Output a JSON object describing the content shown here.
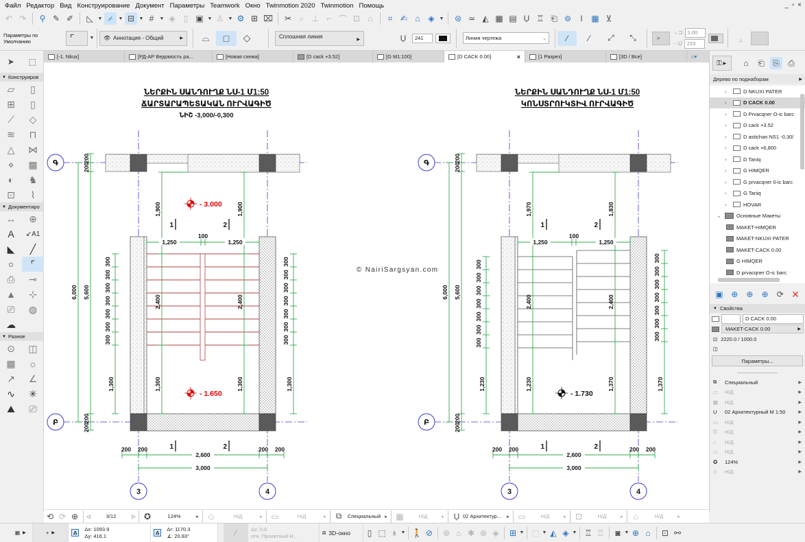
{
  "menu": [
    "Файл",
    "Редактор",
    "Вид",
    "Конструирование",
    "Документ",
    "Параметры",
    "Teamwork",
    "Окно",
    "Twinmotion 2020",
    "Twinmotion",
    "Помощь"
  ],
  "window_controls": "_ ▫ ×",
  "infobox": {
    "favorites_label": "Параметры по Умолчанию",
    "layer": "Аннотация - Общий",
    "line_type": "Сплошная линия",
    "pen_number": "241",
    "line_category": "Линия чертежа",
    "scale_value": "1.00",
    "pen_value_2": "223"
  },
  "tabs": [
    {
      "label": "[-1. Nkux]",
      "active": false
    },
    {
      "label": "[РД-АР Ведомость ра...",
      "active": false
    },
    {
      "label": "[Новая схема]",
      "active": false
    },
    {
      "label": "[D cack +3.52]",
      "active": false
    },
    {
      "label": "[G M1:100]",
      "active": false
    },
    {
      "label": "[D CACK 0.00]",
      "active": true
    },
    {
      "label": "[1 Разрез]",
      "active": false
    },
    {
      "label": "[3D / Все]",
      "active": false
    }
  ],
  "toolbox": {
    "sections": [
      "Конструиров",
      "Документиро",
      "Разное"
    ]
  },
  "navigator": {
    "mode": "Дерево по поднаборам",
    "items": [
      {
        "label": "D NKUXI PATER",
        "type": "view",
        "selected": false
      },
      {
        "label": "D CACK 0.00",
        "type": "view",
        "selected": true
      },
      {
        "label": "D Prvacqner O-ic barc",
        "type": "view",
        "selected": false
      },
      {
        "label": "D cack +3.52",
        "type": "view",
        "selected": false
      },
      {
        "label": "D astichan NS1 -0,30/",
        "type": "view",
        "selected": false
      },
      {
        "label": "D cack +6,800",
        "type": "view",
        "selected": false
      },
      {
        "label": "D Taniq",
        "type": "view",
        "selected": false
      },
      {
        "label": "G HIMQER",
        "type": "view",
        "selected": false
      },
      {
        "label": "G prvacqner 0-ic barc",
        "type": "view",
        "selected": false
      },
      {
        "label": "G Taniq",
        "type": "view",
        "selected": false
      },
      {
        "label": "HOVAR",
        "type": "view",
        "selected": false
      },
      {
        "label": "Основные Макеты",
        "type": "folder",
        "selected": false
      },
      {
        "label": "MAKET-HIMQER",
        "type": "layout",
        "selected": false
      },
      {
        "label": "MAKET-NKUXI PATER",
        "type": "layout",
        "selected": false
      },
      {
        "label": "MAKET-CACK 0.00",
        "type": "layout",
        "selected": false
      },
      {
        "label": "G HIMQER",
        "type": "layout",
        "selected": false
      },
      {
        "label": "D prvacqner O-ic barc",
        "type": "layout",
        "selected": false
      }
    ]
  },
  "properties": {
    "header": "Свойства",
    "id_field": "",
    "name_field": "D CACK 0.00",
    "master": "MAKET-CACK 0.00",
    "size": "2220.0 / 1000.0",
    "params_button": "Параметры...",
    "rows": [
      {
        "label": "Специальный",
        "na": false
      },
      {
        "label": "Н/Д",
        "na": true
      },
      {
        "label": "Н/Д",
        "na": true
      },
      {
        "label": "02 Архитектурный М 1:50",
        "na": false
      },
      {
        "label": "Н/Д",
        "na": true
      },
      {
        "label": "Н/Д",
        "na": true
      },
      {
        "label": "Н/Д",
        "na": true
      },
      {
        "label": "Н/Д",
        "na": true
      },
      {
        "label": "124%",
        "na": false
      },
      {
        "label": "Н/Д",
        "na": true
      }
    ]
  },
  "drawing": {
    "watermark": "© NairiSargsyan.com",
    "left": {
      "title1": "ՆԵՐՔԻՆ ՍԱՆԴՈՒՂՔ  ՆՍ-1  Մ1:50",
      "title2": "ՃԱՐՏԱՐԱՊԵՏԱԿԱՆ ՈՒՐՎԱԳԻԾ",
      "subtitle": "ՆԻՇ -3,000/-0,300",
      "level_top": "- 3.000",
      "level_bottom": "- 1.650",
      "dim_top_left": "1,900",
      "dim_top_right": "1,900",
      "dim_bottom_left": "1,300",
      "dim_bottom_right": "1,300",
      "outer_left_bottom": "1,300",
      "outer_right_bottom": "1,300",
      "level_color": "#e00000",
      "stair_color": "#b04040"
    },
    "right": {
      "title1": "ՆԵՐՔԻՆ ՍԱՆԴՈՒՂՔ  ՆՍ-1  Մ1:50",
      "title2": "ԿՈՆՍՏՐՈՒԿՏԻՎ ՈՒՐՎԱԳԻԾ",
      "subtitle": "",
      "level_top": "",
      "level_bottom": "- 1.730",
      "dim_top_left": "1,970",
      "dim_top_right": "1,830",
      "dim_bottom_left": "1,230",
      "dim_bottom_right": "1,370",
      "outer_left_bottom": "1,230",
      "outer_right_bottom": "1,370",
      "level_color": "#111111",
      "stair_color": "#555555"
    },
    "common": {
      "axis_top": "Գ",
      "axis_bottom": "Բ",
      "axis_left": "3",
      "axis_right": "4",
      "overall_height": "6,000",
      "inner_height": "5,600",
      "wall_200": "200",
      "flight": "2,400",
      "landing_width": "1,250",
      "gap": "100",
      "tread": "300",
      "inner_width": "2,600",
      "axis_width": "3,000",
      "flight_1": "1",
      "flight_2": "2"
    }
  },
  "status": {
    "page": "3/12",
    "zoom": "124%",
    "na": "Н/Д",
    "layer_combo": "Специальный",
    "pen_set": "02 Архитектур...",
    "dx": "Δx: 1093.9",
    "dy": "Δy: 416.1",
    "dr": "Δr: 1170.3",
    "angle": "∡: 20.83°",
    "dz": "Δz: 0.0",
    "ref": "отн. Проектный Н...",
    "window_3d": "3D-окно"
  },
  "colors": {
    "accent": "#cfe4f7",
    "dim_line": "#2fa84a",
    "grid_axis": "#3a3acc",
    "column": "#5a5a5a",
    "close_red": "#e53935"
  }
}
